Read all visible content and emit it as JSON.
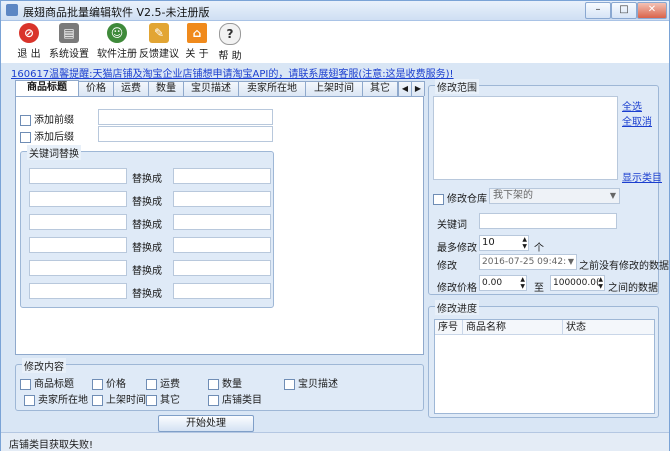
{
  "window": {
    "title": "展翅商品批量编辑软件 V2.5-未注册版",
    "min": "–",
    "max": "□",
    "close": "✕"
  },
  "toolbar": [
    {
      "label": "退 出"
    },
    {
      "label": "系统设置"
    },
    {
      "label": "软件注册"
    },
    {
      "label": "反馈建议"
    },
    {
      "label": "关 于"
    },
    {
      "label": "帮 助"
    }
  ],
  "notice": "160617温馨提醒:天猫店铺及淘宝企业店铺想申请淘宝API的，请联系展翅客服(注意:这是收费服务)!",
  "tabs": [
    "商品标题",
    "价格",
    "运费",
    "数量",
    "宝贝描述",
    "卖家所在地",
    "上架时间",
    "其它"
  ],
  "tab_nav": {
    "left": "◀",
    "right": "▶"
  },
  "title_panel": {
    "prefix_label": "添加前缀",
    "suffix_label": "添加后缀",
    "keyword_group": "关键词替换",
    "replace_label": "替换成"
  },
  "modify_content": {
    "caption": "修改内容",
    "items": [
      "商品标题",
      "价格",
      "运费",
      "数量",
      "宝贝描述",
      "卖家所在地",
      "上架时间",
      "其它",
      "店铺类目"
    ]
  },
  "start_button": "开始处理",
  "scope": {
    "caption": "修改范围",
    "select_all": "全选",
    "select_none": "全取消",
    "show_category": "显示类目"
  },
  "warehouse": {
    "label": "修改仓库",
    "value": "我下架的"
  },
  "keyword": {
    "label": "关键词"
  },
  "max_modify": {
    "label": "最多修改",
    "value": "10",
    "unit": "个"
  },
  "modify_time": {
    "label": "修改",
    "value": "2016-07-25 09:42:",
    "suffix": "之前没有修改的数据"
  },
  "price": {
    "label": "修改价格",
    "from": "0.00",
    "to_label": "至",
    "to": "100000.0(",
    "suffix": "之间的数据"
  },
  "progress": {
    "caption": "修改进度",
    "columns": [
      "序号",
      "商品名称",
      "状态"
    ]
  },
  "status": "店铺类目获取失败!"
}
